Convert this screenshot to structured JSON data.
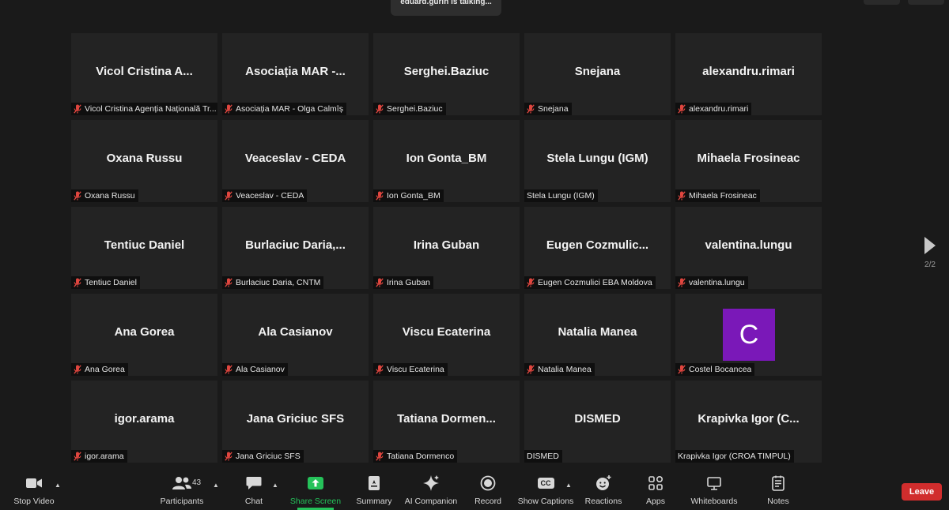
{
  "talking_indicator": "eduard.gurin is talking...",
  "colors": {
    "background": "#1a1a1a",
    "tile": "#232323",
    "share_green": "#25c25a",
    "leave_red": "#d12d2d",
    "avatar_purple": "#7a18b8",
    "muted_mic_red": "#e0463f"
  },
  "tiles": [
    {
      "name": "Vicol  Cristina  A...",
      "label": "Vicol Cristina Agenția Națională Tr...",
      "muted": true
    },
    {
      "name": "Asociația  MAR  -...",
      "label": "Asociația MAR - Olga Calmîș",
      "muted": true
    },
    {
      "name": "Serghei.Baziuc",
      "label": "Serghei.Baziuc",
      "muted": true
    },
    {
      "name": "Snejana",
      "label": "Snejana",
      "muted": true
    },
    {
      "name": "alexandru.rimari",
      "label": "alexandru.rimari",
      "muted": true
    },
    {
      "name": "Oxana Russu",
      "label": "Oxana Russu",
      "muted": true
    },
    {
      "name": "Veaceslav - CEDA",
      "label": "Veaceslav - CEDA",
      "muted": true
    },
    {
      "name": "Ion Gonta_BM",
      "label": "Ion Gonta_BM",
      "muted": true
    },
    {
      "name": "Stela Lungu (IGM)",
      "label": "Stela Lungu (IGM)",
      "muted": false
    },
    {
      "name": "Mihaela Frosineac",
      "label": "Mihaela Frosineac",
      "muted": true
    },
    {
      "name": "Tentiuc Daniel",
      "label": "Tentiuc Daniel",
      "muted": true
    },
    {
      "name": "Burlaciuc  Daria,...",
      "label": "Burlaciuc Daria, CNTM",
      "muted": true
    },
    {
      "name": "Irina Guban",
      "label": "Irina Guban",
      "muted": true
    },
    {
      "name": "Eugen  Cozmulic...",
      "label": "Eugen Cozmulici EBA Moldova",
      "muted": true
    },
    {
      "name": "valentina.lungu",
      "label": "valentina.lungu",
      "muted": true
    },
    {
      "name": "Ana Gorea",
      "label": "Ana Gorea",
      "muted": true
    },
    {
      "name": "Ala Casianov",
      "label": "Ala Casianov",
      "muted": true
    },
    {
      "name": "Viscu Ecaterina",
      "label": "Viscu Ecaterina",
      "muted": true
    },
    {
      "name": "Natalia Manea",
      "label": "Natalia Manea",
      "muted": true
    },
    {
      "name": "",
      "label": "Costel Bocancea",
      "muted": true,
      "avatar_letter": "C"
    },
    {
      "name": "igor.arama",
      "label": "igor.arama",
      "muted": true
    },
    {
      "name": "Jana Griciuc SFS",
      "label": "Jana Griciuc SFS",
      "muted": true
    },
    {
      "name": "Tatiana  Dormen...",
      "label": "Tatiana Dormenco",
      "muted": true
    },
    {
      "name": "DISMED",
      "label": "DISMED",
      "muted": false
    },
    {
      "name": "Krapivka  Igor  (C...",
      "label": "Krapivka Igor (CROA TIMPUL)",
      "muted": false
    }
  ],
  "pager": {
    "text": "2/2"
  },
  "toolbar": {
    "stop_video": "Stop Video",
    "participants": "Participants",
    "participants_count": "43",
    "chat": "Chat",
    "share_screen": "Share Screen",
    "summary": "Summary",
    "ai_companion": "AI Companion",
    "record": "Record",
    "show_captions": "Show Captions",
    "cc_icon_text": "CC",
    "reactions": "Reactions",
    "apps": "Apps",
    "whiteboards": "Whiteboards",
    "notes": "Notes",
    "leave": "Leave"
  }
}
